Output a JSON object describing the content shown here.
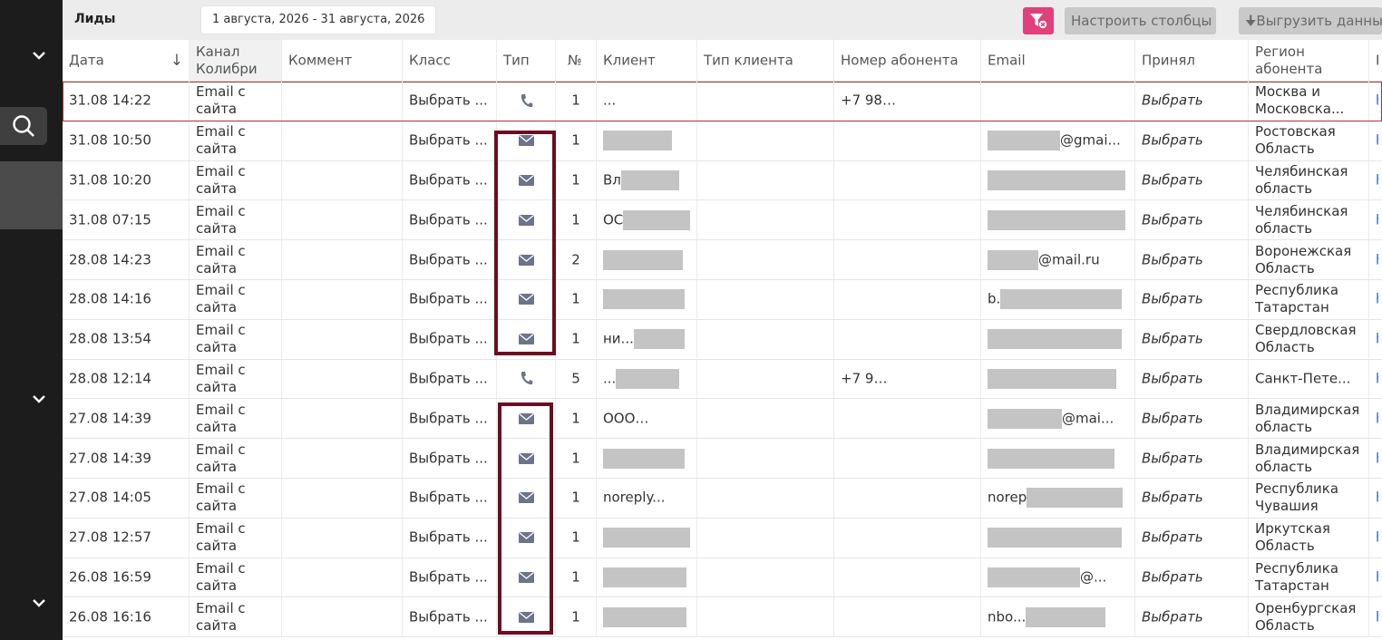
{
  "header": {
    "title": "Лиды",
    "date_range": "1 августа, 2026 - 31 августа, 2026",
    "configure_columns": "Настроить столбцы",
    "export": "Выгрузить данные"
  },
  "columns": {
    "date": "Дата",
    "channel": "Канал Колибри",
    "comment": "Коммент",
    "class": "Класс",
    "type": "Тип",
    "num": "№",
    "client": "Клиент",
    "client_type": "Тип клиента",
    "phone": "Номер абонента",
    "email": "Email",
    "accepted": "Принял",
    "region": "Регион абонента",
    "extra": "П"
  },
  "rows": [
    {
      "date": "31.08 14:22",
      "channel": "Email с сайта",
      "class": "Выбрать ...",
      "type": "phone",
      "num": "1",
      "client": "...",
      "phone": "+7 98",
      "email": "",
      "accepted": "Выбрать",
      "region": "Москва и Московска...",
      "extra": "h"
    },
    {
      "date": "31.08 10:50",
      "channel": "Email с сайта",
      "class": "Выбрать ...",
      "type": "email",
      "num": "1",
      "client": "",
      "phone": "",
      "email": "@gmai...",
      "accepted": "Выбрать",
      "region": "Ростовская Область",
      "extra": "h"
    },
    {
      "date": "31.08 10:20",
      "channel": "Email с сайта",
      "class": "Выбрать ...",
      "type": "email",
      "num": "1",
      "client": "Вл",
      "phone": "",
      "email": "",
      "accepted": "Выбрать",
      "region": "Челябинская область",
      "extra": "h"
    },
    {
      "date": "31.08 07:15",
      "channel": "Email с сайта",
      "class": "Выбрать ...",
      "type": "email",
      "num": "1",
      "client": "ОС",
      "phone": "",
      "email": "",
      "accepted": "Выбрать",
      "region": "Челябинская область",
      "extra": "h"
    },
    {
      "date": "28.08 14:23",
      "channel": "Email с сайта",
      "class": "Выбрать ...",
      "type": "email",
      "num": "2",
      "client": "",
      "phone": "",
      "email": "@mail.ru",
      "accepted": "Выбрать",
      "region": "Воронежская Область",
      "extra": "h"
    },
    {
      "date": "28.08 14:16",
      "channel": "Email с сайта",
      "class": "Выбрать ...",
      "type": "email",
      "num": "1",
      "client": "",
      "phone": "",
      "email": "b.",
      "accepted": "Выбрать",
      "region": "Республика Татарстан",
      "extra": "h"
    },
    {
      "date": "28.08 13:54",
      "channel": "Email с сайта",
      "class": "Выбрать ...",
      "type": "email",
      "num": "1",
      "client": "ни...",
      "phone": "",
      "email": "",
      "accepted": "Выбрать",
      "region": "Свердловская Область",
      "extra": "h"
    },
    {
      "date": "28.08 12:14",
      "channel": "Email с сайта",
      "class": "Выбрать ...",
      "type": "phone",
      "num": "5",
      "client": "...",
      "phone": "+7 9",
      "email": "",
      "accepted": "Выбрать",
      "region": "Санкт-Пете...",
      "extra": "h"
    },
    {
      "date": "27.08 14:39",
      "channel": "Email с сайта",
      "class": "Выбрать ...",
      "type": "email",
      "num": "1",
      "client": "ООО",
      "phone": "",
      "email": "@mai...",
      "accepted": "Выбрать",
      "region": "Владимирская область",
      "extra": "h"
    },
    {
      "date": "27.08 14:39",
      "channel": "Email с сайта",
      "class": "Выбрать ...",
      "type": "email",
      "num": "1",
      "client": "",
      "phone": "",
      "email": "",
      "accepted": "Выбрать",
      "region": "Владимирская область",
      "extra": "h"
    },
    {
      "date": "27.08 14:05",
      "channel": "Email с сайта",
      "class": "Выбрать ...",
      "type": "email",
      "num": "1",
      "client": "noreply...",
      "phone": "",
      "email": "norep",
      "accepted": "Выбрать",
      "region": "Республика Чувашия",
      "extra": "h"
    },
    {
      "date": "27.08 12:57",
      "channel": "Email с сайта",
      "class": "Выбрать ...",
      "type": "email",
      "num": "1",
      "client": "",
      "phone": "",
      "email": "",
      "accepted": "Выбрать",
      "region": "Иркутская Область",
      "extra": "h"
    },
    {
      "date": "26.08 16:59",
      "channel": "Email с сайта",
      "class": "Выбрать ...",
      "type": "email",
      "num": "1",
      "client": "",
      "phone": "",
      "email": "@...",
      "accepted": "Выбрать",
      "region": "Республика Татарстан",
      "extra": "h"
    },
    {
      "date": "26.08 16:16",
      "channel": "Email с сайта",
      "class": "Выбрать ...",
      "type": "email",
      "num": "1",
      "client": "",
      "phone": "",
      "email": "nbo...",
      "accepted": "Выбрать",
      "region": "Оренбургская Область",
      "extra": "h"
    }
  ],
  "colors": {
    "sidebar": "#1c1c1c",
    "filter_button": "#e0407b",
    "highlight": "#6b0d22",
    "icon": "#6d7388"
  }
}
